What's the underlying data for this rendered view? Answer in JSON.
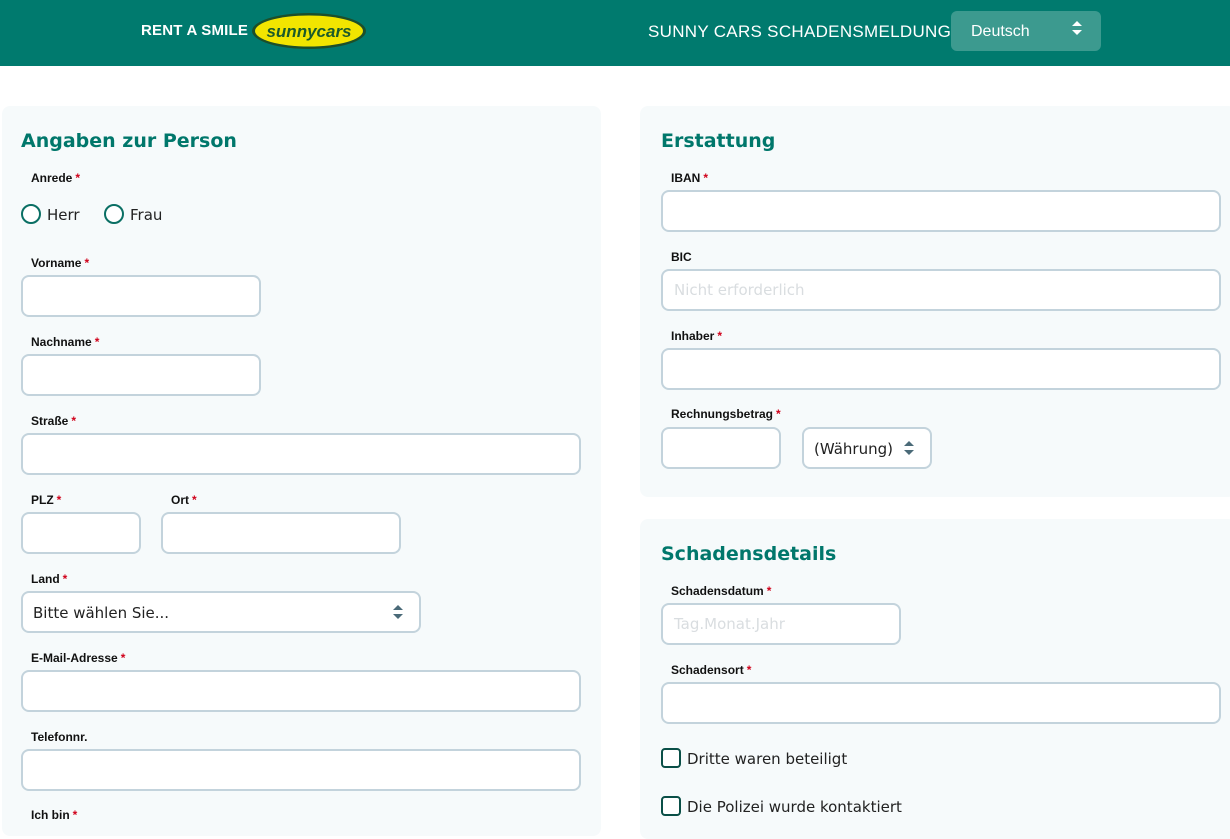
{
  "header": {
    "brand_text": "RENT A SMILE",
    "logo_text": "sunnycars",
    "title": "SUNNY CARS SCHADENSMELDUNG",
    "language": "Deutsch"
  },
  "person": {
    "title": "Angaben zur Person",
    "anrede_label": "Anrede",
    "anrede_options": [
      "Herr",
      "Frau"
    ],
    "vorname_label": "Vorname",
    "nachname_label": "Nachname",
    "strasse_label": "Straße",
    "plz_label": "PLZ",
    "ort_label": "Ort",
    "land_label": "Land",
    "land_value": "Bitte wählen Sie...",
    "email_label": "E-Mail-Adresse",
    "telefon_label": "Telefonnr.",
    "ichbin_label": "Ich bin"
  },
  "erstattung": {
    "title": "Erstattung",
    "iban_label": "IBAN",
    "bic_label": "BIC",
    "bic_placeholder": "Nicht erforderlich",
    "inhaber_label": "Inhaber",
    "betrag_label": "Rechnungsbetrag",
    "waehrung_value": "(Währung)"
  },
  "schaden": {
    "title": "Schadensdetails",
    "datum_label": "Schadensdatum",
    "datum_placeholder": "Tag.Monat.Jahr",
    "ort_label": "Schadensort",
    "dritte_label": "Dritte waren beteiligt",
    "polizei_label": "Die Polizei wurde kontaktiert"
  },
  "required_marker": "*",
  "colors": {
    "header_bg": "#007a6e",
    "accent": "#00776b",
    "required": "#d0021b",
    "logo_yellow": "#f2e500"
  }
}
